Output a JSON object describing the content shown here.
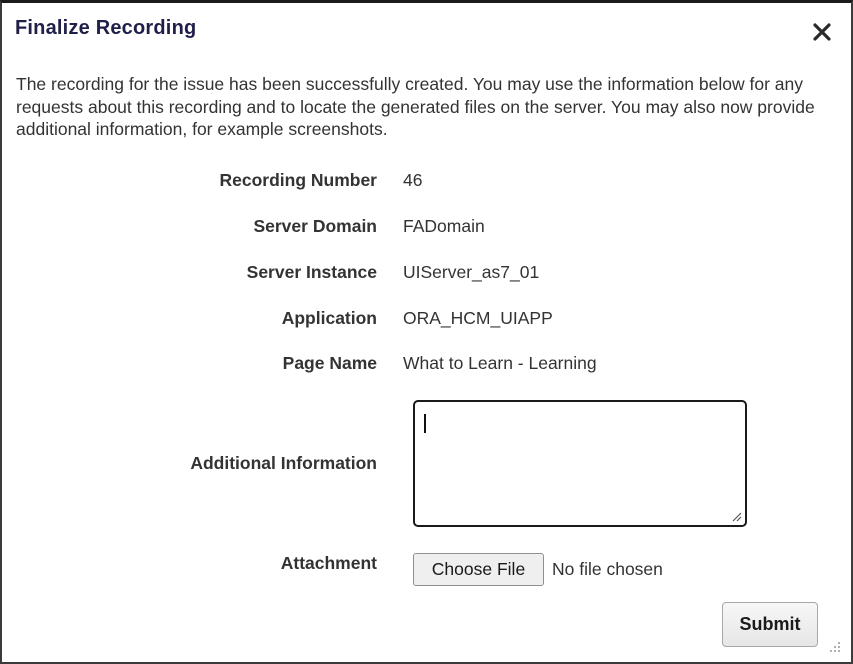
{
  "dialog": {
    "title": "Finalize Recording",
    "close_icon": "close-icon",
    "intro": "The recording for the issue has been successfully created. You may use the information below for any requests about this recording and to locate the generated files on the server. You may also now provide additional information, for example screenshots."
  },
  "fields": [
    {
      "label": "Recording Number",
      "value": "46"
    },
    {
      "label": "Server Domain",
      "value": "FADomain"
    },
    {
      "label": "Server Instance",
      "value": "UIServer_as7_01"
    },
    {
      "label": "Application",
      "value": "ORA_HCM_UIAPP"
    },
    {
      "label": "Page Name",
      "value": "What to Learn - Learning"
    }
  ],
  "additional_info": {
    "label": "Additional Information",
    "value": ""
  },
  "attachment": {
    "label": "Attachment",
    "button_label": "Choose File",
    "status": "No file chosen"
  },
  "actions": {
    "submit_label": "Submit"
  },
  "colors": {
    "title": "#1f1f4a",
    "text": "#333333",
    "border": "#1a1a1a"
  }
}
